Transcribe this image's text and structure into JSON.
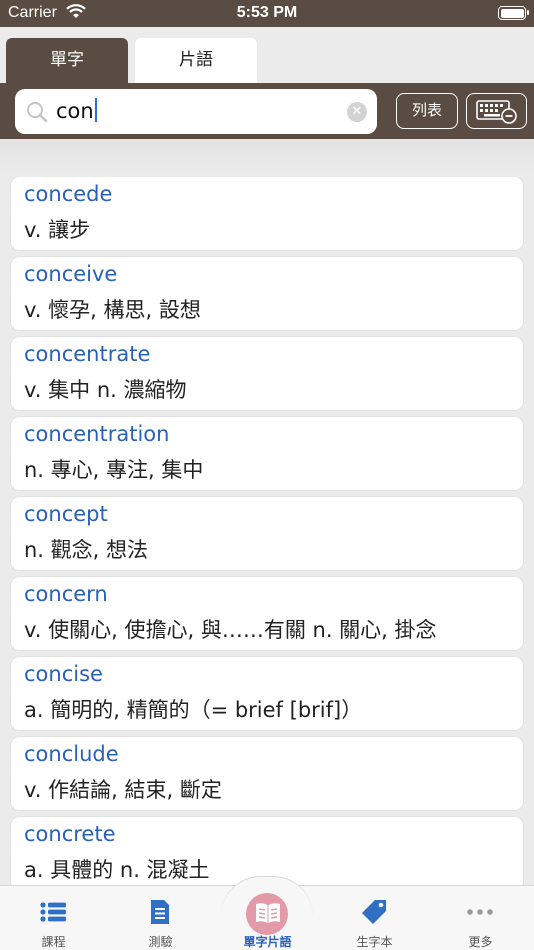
{
  "status_bar": {
    "carrier": "Carrier",
    "time": "5:53 PM"
  },
  "tabs": [
    {
      "label": "單字",
      "active": true
    },
    {
      "label": "片語",
      "active": false
    }
  ],
  "search": {
    "value": "con",
    "list_button": "列表"
  },
  "words": [
    {
      "word": "concede",
      "definition": "v. 讓步"
    },
    {
      "word": "conceive",
      "definition": "v. 懷孕, 構思, 設想"
    },
    {
      "word": "concentrate",
      "definition": "v. 集中  n. 濃縮物"
    },
    {
      "word": "concentration",
      "definition": "n. 專心, 專注, 集中"
    },
    {
      "word": "concept",
      "definition": "n. 觀念, 想法"
    },
    {
      "word": "concern",
      "definition": "v. 使關心, 使擔心, 與……有關  n. 關心, 掛念"
    },
    {
      "word": "concise",
      "definition": "a. 簡明的, 精簡的（= brief [brif]）"
    },
    {
      "word": "conclude",
      "definition": "v. 作結論, 結束, 斷定"
    },
    {
      "word": "concrete",
      "definition": "a. 具體的  n. 混凝土"
    }
  ],
  "bottom_nav": [
    {
      "label": "課程",
      "icon": "list-icon"
    },
    {
      "label": "測驗",
      "icon": "document-icon"
    },
    {
      "label": "單字片語",
      "icon": "book-icon",
      "active": true
    },
    {
      "label": "生字本",
      "icon": "tag-icon"
    },
    {
      "label": "更多",
      "icon": "more-icon"
    }
  ],
  "colors": {
    "header_brown": "#5a4c42",
    "word_blue": "#2a62b8",
    "active_circle_pink": "#e29aa8",
    "icon_blue": "#2f6fc4"
  }
}
